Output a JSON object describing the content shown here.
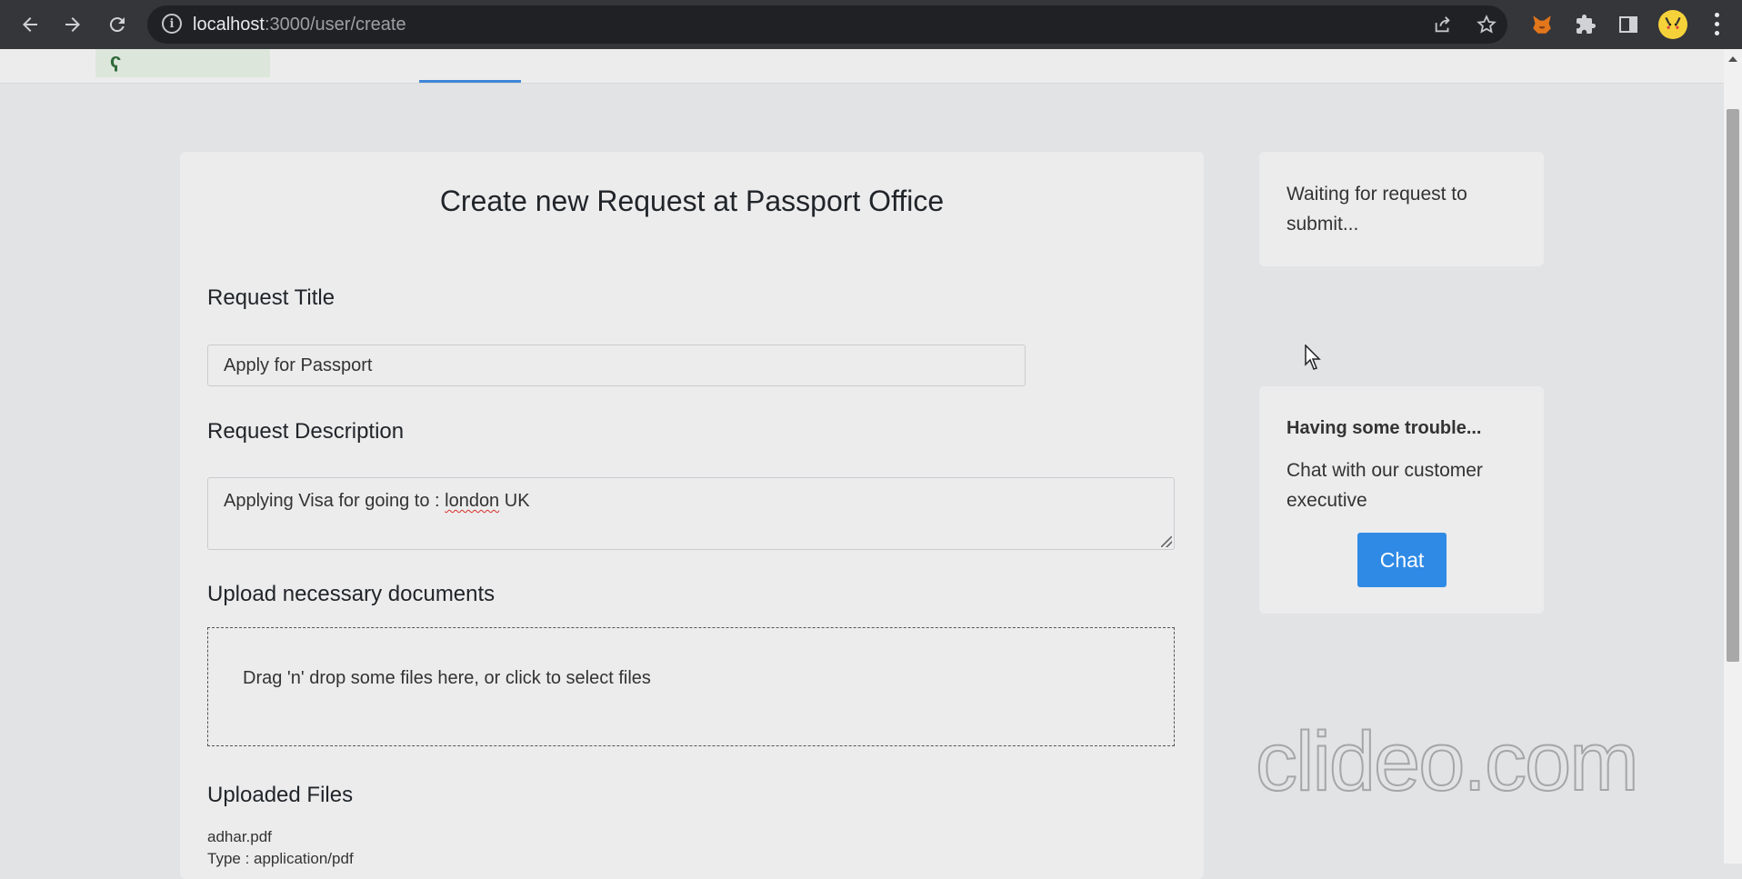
{
  "browser": {
    "url_host": "localhost",
    "url_path": ":3000/user/create",
    "icons": {
      "back": "arrow-left-icon",
      "forward": "arrow-right-icon",
      "reload": "reload-icon",
      "info": "info-icon",
      "share": "share-icon",
      "bookmark": "star-icon",
      "metamask": "fox-extension-icon",
      "extensions": "puzzle-icon",
      "sidepanel": "side-panel-icon",
      "profile": "pikachu-avatar",
      "menu": "kebab-menu-icon"
    }
  },
  "form": {
    "title": "Create new Request at Passport Office",
    "request_title_label": "Request Title",
    "request_title_value": "Apply for Passport",
    "description_label": "Request Description",
    "description_value_prefix": "Applying Visa for going to : ",
    "description_value_misspelled": "london",
    "description_value_suffix": " UK",
    "upload_label": "Upload necessary documents",
    "dropzone_text": "Drag 'n' drop some files here, or click to select files",
    "uploaded_label": "Uploaded Files",
    "files": [
      {
        "name": "adhar.pdf",
        "type": "Type : application/pdf"
      }
    ]
  },
  "status_card": {
    "text": "Waiting for request to submit..."
  },
  "help_card": {
    "title": "Having some trouble...",
    "text": "Chat with our customer executive",
    "button_label": "Chat"
  },
  "colors": {
    "chrome_bg": "#35363a",
    "page_bg": "#e2e3e5",
    "card_bg": "#ececed",
    "accent": "#2f8ae5",
    "nav_underline": "#3f86d8"
  },
  "watermark": "clideo.com"
}
